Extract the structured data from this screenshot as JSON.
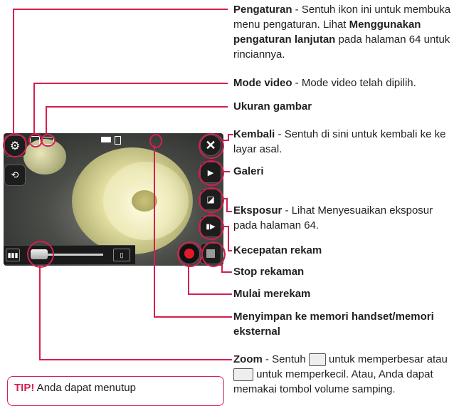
{
  "labels": {
    "pengaturan": {
      "title": "Pengaturan",
      "text1": " - Sentuh ikon ini untuk membuka menu pengaturan. Lihat ",
      "bold": "Menggunakan pengaturan lanjutan",
      "text2": " pada halaman 64 untuk rinciannya."
    },
    "mode_video": {
      "title": "Mode video",
      "text": " - Mode video telah dipilih."
    },
    "ukuran_gambar": {
      "title": "Ukuran gambar"
    },
    "kembali": {
      "title": "Kembali",
      "text": " - Sentuh di sini untuk kembali ke ke layar asal."
    },
    "galeri": {
      "title": "Galeri"
    },
    "eksposur": {
      "title": "Eksposur",
      "text": " - Lihat Menyesuaikan eksposur pada halaman 64."
    },
    "kecepatan_rekam": {
      "title": "Kecepatan rekam"
    },
    "stop_rekaman": {
      "title": "Stop rekaman"
    },
    "mulai_merekam": {
      "title": "Mulai merekam"
    },
    "menyimpan": {
      "title": "Menyimpan ke memori handset/memori eksternal"
    },
    "zoom": {
      "title": "Zoom",
      "text1": " - Sentuh ",
      "text2": " untuk memperbesar atau ",
      "text3": " untuk memperkecil. Atau, Anda dapat memakai tombol volume samping."
    }
  },
  "tip": {
    "head": "TIP!",
    "text": " Anda dapat menutup"
  },
  "colors": {
    "accent": "#d41f4f",
    "text": "#231f20"
  },
  "icons": [
    "gear-icon",
    "camera-switch-icon",
    "close-icon",
    "gallery-icon",
    "exposure-icon",
    "record-speed-icon",
    "record-icon",
    "stop-icon",
    "zoom-in-icon",
    "zoom-out-icon",
    "video-mode-icon",
    "image-size-icon",
    "battery-icon",
    "memory-icon"
  ]
}
